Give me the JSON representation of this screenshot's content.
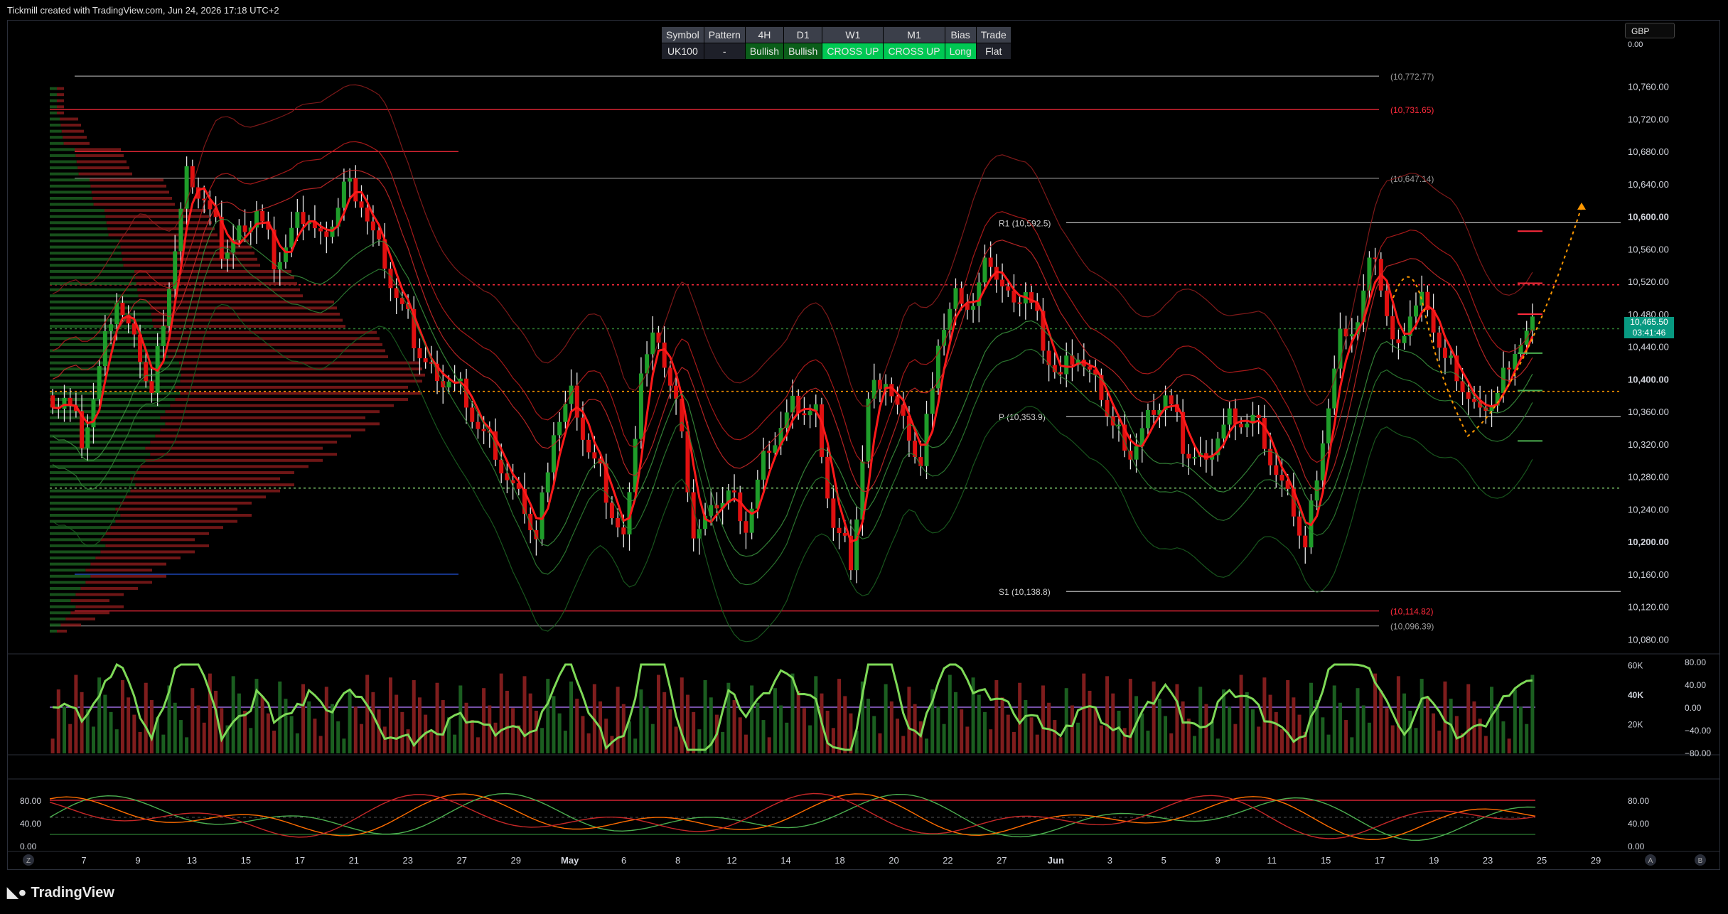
{
  "header": {
    "credit": "Tickmill created with TradingView.com, Jun 24, 2026 17:18 UTC+2"
  },
  "status_table": {
    "headers": [
      "Symbol",
      "Pattern",
      "4H",
      "D1",
      "W1",
      "M1",
      "Bias",
      "Trade"
    ],
    "values": [
      "UK100",
      "-",
      "Bullish",
      "Bullish",
      "CROSS UP",
      "CROSS UP",
      "Long",
      "Flat"
    ],
    "cell_colors": [
      "#1e2029",
      "#1e2029",
      "#0b5e1a",
      "#0b5e1a",
      "#00c853",
      "#00c853",
      "#00c853",
      "#1e2029"
    ]
  },
  "currency": "GBP",
  "currency_tick": "0.00",
  "last_price": {
    "price": "10,465.50",
    "countdown": "03:41:46"
  },
  "footer": {
    "brand": "TradingView",
    "scroll_left": "Z",
    "auto_btn": "A",
    "b_btn": "B"
  },
  "colors": {
    "bull": "#089981",
    "bear": "#f23645",
    "candle_up": "#1f9d2a",
    "candle_down": "#e01010",
    "resistance": "#ff2b3c",
    "gray_line": "#9a9a9a",
    "orange": "#ff9800",
    "purple": "#9c6ade"
  },
  "chart_data": [
    {
      "type": "line",
      "title": "",
      "price_axis": [
        "10,760.00",
        "10,720.00",
        "10,680.00",
        "10,640.00",
        "10,600.00",
        "10,560.00",
        "10,520.00",
        "10,480.00",
        "10,440.00",
        "10,400.00",
        "10,360.00",
        "10,320.00",
        "10,280.00",
        "10,240.00",
        "10,200.00",
        "10,160.00",
        "10,120.00",
        "10,080.00"
      ],
      "price_values": [
        10760,
        10720,
        10680,
        10640,
        10600,
        10560,
        10520,
        10480,
        10440,
        10400,
        10360,
        10320,
        10280,
        10240,
        10200,
        10160,
        10120,
        10080
      ],
      "bold_ticks": [
        10600,
        10400,
        10200
      ],
      "ylim": [
        10062,
        10779
      ],
      "x_labels": [
        "7",
        "9",
        "13",
        "15",
        "17",
        "21",
        "23",
        "27",
        "29",
        "May",
        "6",
        "8",
        "12",
        "14",
        "18",
        "20",
        "22",
        "27",
        "Jun",
        "3",
        "5",
        "9",
        "11",
        "15",
        "17",
        "19",
        "23",
        "25",
        "29"
      ],
      "levels": [
        {
          "label": "(10,772.77)",
          "value": 10772.77,
          "color": "#9a9a9a"
        },
        {
          "label": "(10,731.65)",
          "value": 10731.65,
          "color": "#ff2b3c"
        },
        {
          "label": "(10,647.14)",
          "value": 10647.14,
          "color": "#9a9a9a"
        },
        {
          "label": "R1 (10,592.5)",
          "value": 10592.5,
          "color": "#cfcfcf"
        },
        {
          "label": "P (10,353.9)",
          "value": 10353.9,
          "color": "#cfcfcf"
        },
        {
          "label": "S1 (10,138.8)",
          "value": 10138.8,
          "color": "#cfcfcf"
        },
        {
          "label": "(10,114.82)",
          "value": 10114.82,
          "color": "#ff2b3c"
        },
        {
          "label": "(10,096.39)",
          "value": 10096.39,
          "color": "#9a9a9a"
        }
      ],
      "dotted_levels": [
        {
          "value": 10516,
          "color": "#ff2b3c"
        },
        {
          "value": 10385,
          "color": "#ff9800"
        },
        {
          "value": 10266,
          "color": "#7cc96b"
        },
        {
          "value": 10462,
          "color": "#2e7d32"
        }
      ],
      "close_path": [
        10380,
        10330,
        10410,
        10500,
        10440,
        10380,
        10520,
        10650,
        10620,
        10560,
        10580,
        10610,
        10550,
        10580,
        10600,
        10560,
        10640,
        10620,
        10560,
        10500,
        10450,
        10410,
        10400,
        10380,
        10330,
        10290,
        10250,
        10200,
        10340,
        10380,
        10310,
        10260,
        10200,
        10410,
        10460,
        10370,
        10210,
        10230,
        10260,
        10220,
        10300,
        10340,
        10370,
        10360,
        10220,
        10180,
        10370,
        10400,
        10340,
        10290,
        10450,
        10500,
        10490,
        10550,
        10500,
        10510,
        10450,
        10400,
        10430,
        10390,
        10340,
        10310,
        10350,
        10380,
        10320,
        10300,
        10330,
        10360,
        10350,
        10300,
        10250,
        10190,
        10330,
        10450,
        10470,
        10560,
        10440,
        10480,
        10500,
        10420,
        10390,
        10350,
        10380,
        10440,
        10465
      ]
    },
    {
      "type": "bar",
      "title": "",
      "volume_axis": [
        "60K",
        "40K",
        "20K"
      ],
      "volume_values": [
        60000,
        40000,
        20000
      ],
      "osc_axis": [
        "80.00",
        "40.00",
        "0.00",
        "−40.00",
        "−80.00"
      ],
      "osc_values": [
        80,
        40,
        0,
        -40,
        -80
      ]
    },
    {
      "type": "line",
      "title": "",
      "axis_left": [
        "80.00",
        "40.00",
        "0.00"
      ],
      "axis_right": [
        "80.00",
        "40.00",
        "0.00"
      ],
      "axis_values": [
        80,
        40,
        0
      ]
    }
  ]
}
